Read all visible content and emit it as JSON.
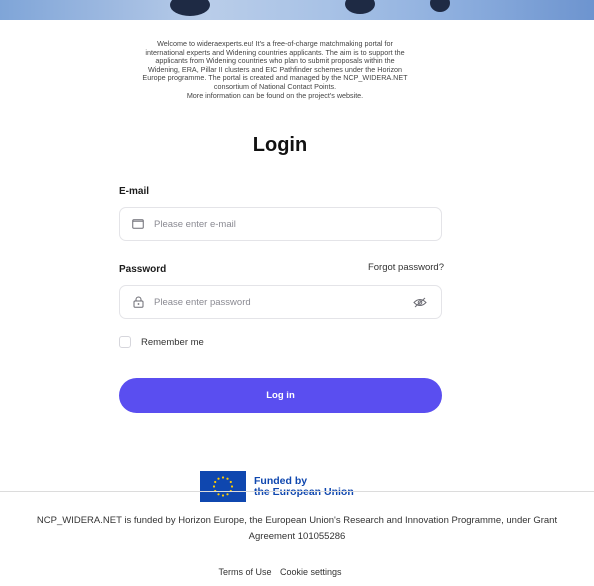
{
  "intro": {
    "lines": [
      "Welcome to wideraexperts.eu! It's a free-of-charge matchmaking portal for",
      "international experts and Widening countries applicants. The aim is to support the",
      "applicants from Widening countries who plan to submit proposals within the",
      "Widening, ERA, Pillar II clusters and EIC Pathfinder schemes under the Horizon",
      "Europe programme. The portal is created and managed by the NCP_WIDERA.NET",
      "consortium of National Contact Points.",
      "More information can be found on the project's website."
    ]
  },
  "login": {
    "title": "Login",
    "email_label": "E-mail",
    "email_placeholder": "Please enter e-mail",
    "email_icon": "envelope-icon",
    "password_label": "Password",
    "password_placeholder": "Please enter password",
    "password_icon": "lock-icon",
    "visibility_icon": "eye-off-icon",
    "forgot_password": "Forgot password?",
    "remember_me": "Remember me",
    "remember_checked": false,
    "submit_label": "Log in"
  },
  "funding": {
    "line1": "Funded by",
    "line2": "the European Union",
    "flag_icon": "eu-flag-icon"
  },
  "footer": {
    "line1": "NCP_WIDERA.NET is funded by Horizon Europe, the European Union's Research and Innovation Programme, under Grant",
    "line2": "Agreement 101055286",
    "links": [
      "Terms of Use",
      "Cookie settings"
    ]
  },
  "colors": {
    "accent": "#5a4ef0",
    "eu_blue": "#0f47af",
    "eu_gold": "#ffcc00"
  }
}
